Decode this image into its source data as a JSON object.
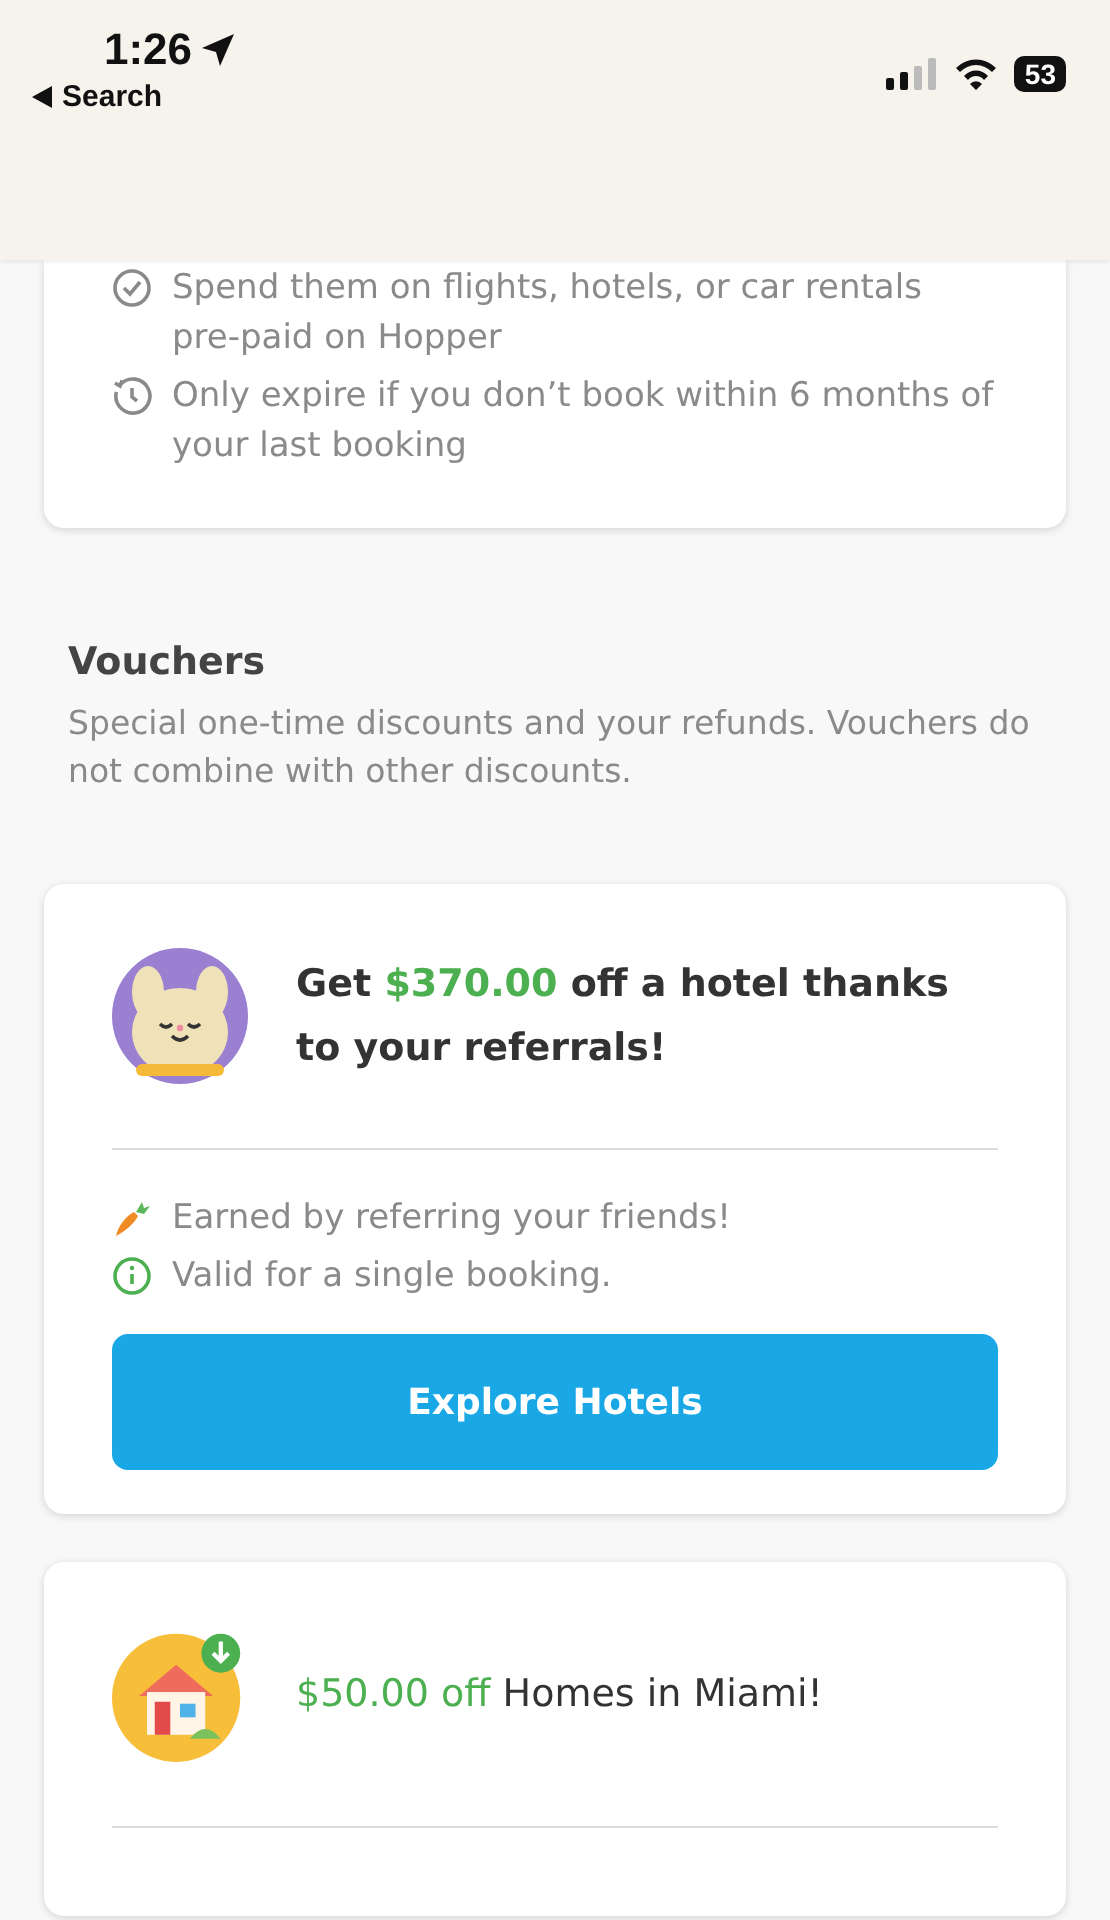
{
  "status_bar": {
    "time": "1:26",
    "back_label": "Search",
    "battery": "53"
  },
  "benefits_card": {
    "bullets": [
      {
        "kind": "check",
        "text": "Spend them on flights, hotels, or car rentals pre-paid on Hopper"
      },
      {
        "kind": "clock",
        "text": "Only expire if you don’t book within 6 months of your last booking"
      }
    ]
  },
  "vouchers": {
    "title": "Vouchers",
    "description": "Special one-time discounts and your refunds. Vouchers do not combine with other discounts."
  },
  "voucher_cards": [
    {
      "kind": "bunny",
      "headline": {
        "prefix": "Get ",
        "amount": "$370.00",
        "suffix": " off a hotel thanks to your referrals!"
      },
      "bullets": [
        {
          "kind": "carrot",
          "text": "Earned by referring your friends!"
        },
        {
          "kind": "info",
          "text": "Valid for a single booking."
        }
      ],
      "button": "Explore Hotels"
    },
    {
      "kind": "house",
      "headline": {
        "amount": "$50.00 off",
        "suffix": " Homes in Miami!"
      }
    }
  ]
}
